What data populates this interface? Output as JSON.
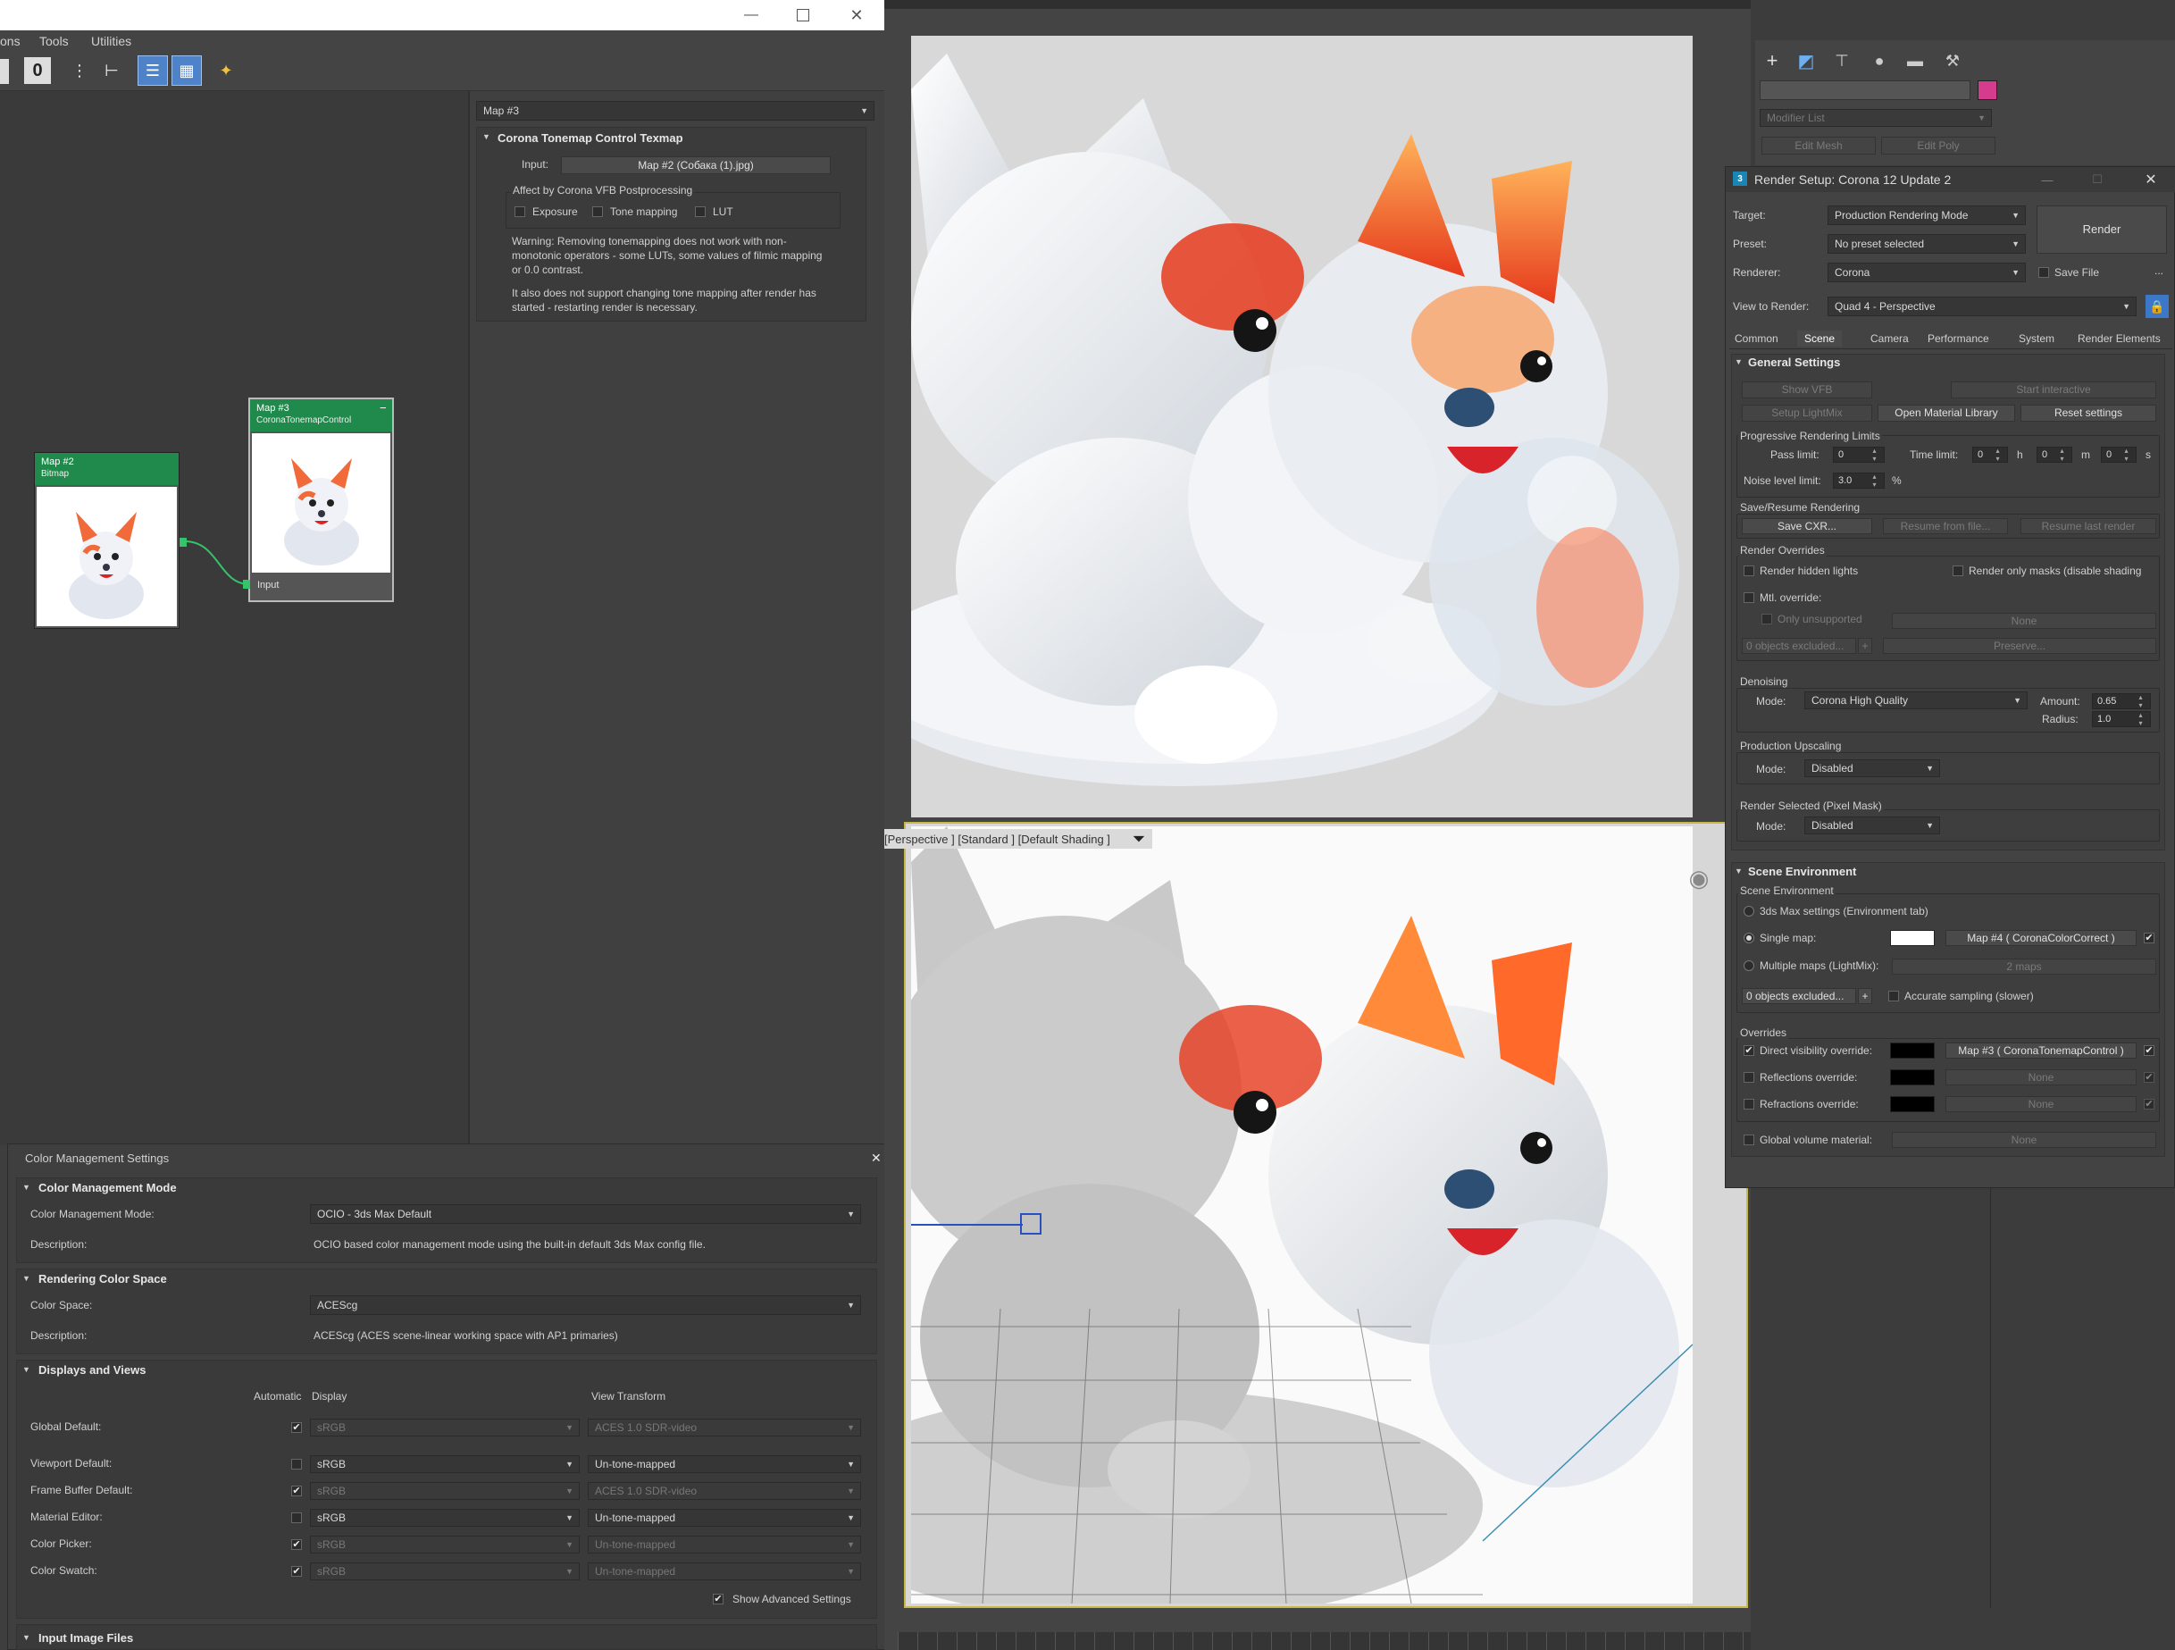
{
  "menu": {
    "items": [
      "ons",
      "Tools",
      "Utilities"
    ]
  },
  "toolbar": {
    "zero": "0"
  },
  "param_editor": {
    "map_name": "Map #3",
    "rollout_title": "Corona Tonemap Control Texmap",
    "input_label": "Input:",
    "input_value": "Map #2 (Собака (1).jpg)",
    "affect_label": "Affect by Corona VFB Postprocessing",
    "exposure": "Exposure",
    "tone_mapping": "Tone mapping",
    "lut": "LUT",
    "warning": "Warning: Removing tonemapping does not work with non-monotonic operators - some LUTs, some values of filmic mapping or 0.0 contrast.",
    "note": "It also does not support changing tone mapping after render has started - restarting render is necessary."
  },
  "nodes": {
    "map2": {
      "title": "Map #2",
      "type": "Bitmap"
    },
    "map3": {
      "title": "Map #3",
      "type": "CoronaTonemapControl",
      "port": "Input",
      "collapse": "−"
    }
  },
  "viewport": {
    "label": "[Perspective ] [Standard ] [Default Shading ]"
  },
  "command_panel": {
    "modifier_list": "Modifier List",
    "edit_mesh": "Edit Mesh",
    "edit_poly": "Edit Poly",
    "color": "#d63c8e"
  },
  "render_setup": {
    "title": "Render Setup: Corona 12 Update 2",
    "target_label": "Target:",
    "target": "Production Rendering Mode",
    "preset_label": "Preset:",
    "preset": "No preset selected",
    "renderer_label": "Renderer:",
    "renderer": "Corona",
    "save_file": "Save File",
    "more": "...",
    "view_label": "View to Render:",
    "view": "Quad 4 - Perspective",
    "render_btn": "Render",
    "tabs": [
      "Common",
      "Scene",
      "Camera",
      "Performance",
      "System",
      "Render Elements"
    ],
    "general": {
      "title": "General Settings",
      "show_vfb": "Show VFB",
      "start_interactive": "Start interactive",
      "setup_lightmix": "Setup LightMix",
      "open_material_library": "Open Material Library",
      "reset_settings": "Reset settings",
      "prog_title": "Progressive Rendering Limits",
      "pass_limit_label": "Pass limit:",
      "pass_limit": "0",
      "time_limit_label": "Time limit:",
      "h": "0",
      "h_unit": "h",
      "m": "0",
      "m_unit": "m",
      "s": "0",
      "s_unit": "s",
      "noise_label": "Noise level limit:",
      "noise": "3.0",
      "percent": "%",
      "save_title": "Save/Resume Rendering",
      "save_cxr": "Save CXR...",
      "resume_file": "Resume from file...",
      "resume_last": "Resume last render",
      "overrides_title": "Render Overrides",
      "render_hidden": "Render hidden lights",
      "render_masks": "Render only masks (disable shading",
      "mtl_override": "Mtl. override:",
      "only_unsupported": "Only unsupported",
      "none": "None",
      "objects_excluded": "0 objects excluded...",
      "plus": "+",
      "preserve": "Preserve...",
      "denoise_title": "Denoising",
      "mode_label": "Mode:",
      "denoise_mode": "Corona High Quality",
      "amount_label": "Amount:",
      "amount": "0.65",
      "radius_label": "Radius:",
      "radius": "1.0",
      "upscale_title": "Production Upscaling",
      "upscale_mode": "Disabled",
      "mask_title": "Render Selected (Pixel Mask)",
      "mask_mode": "Disabled"
    },
    "scene_env": {
      "title": "Scene Environment",
      "sub": "Scene Environment",
      "opt1": "3ds Max settings (Environment tab)",
      "opt2": "Single map:",
      "single_map": "Map #4  ( CoronaColorCorrect )",
      "opt3": "Multiple maps (LightMix):",
      "maps": "2 maps",
      "objects_excluded": "0 objects excluded...",
      "plus": "+",
      "accurate": "Accurate sampling (slower)",
      "overrides": "Overrides",
      "direct": "Direct visibility override:",
      "direct_map": "Map #3  ( CoronaTonemapControl )",
      "reflections": "Reflections override:",
      "refractions": "Refractions override:",
      "none": "None",
      "global_volume": "Global volume material:"
    }
  },
  "color_mgmt": {
    "title": "Color Management Settings",
    "close": "✕",
    "mode_section": "Color Management Mode",
    "mode_label": "Color Management Mode:",
    "mode": "OCIO - 3ds Max Default",
    "desc_label": "Description:",
    "mode_desc": "OCIO based color management mode using the built-in default 3ds Max config file.",
    "space_section": "Rendering Color Space",
    "space_label": "Color Space:",
    "space": "ACEScg",
    "space_desc": "ACEScg (ACES scene-linear working space with AP1 primaries)",
    "displays_section": "Displays and Views",
    "col_automatic": "Automatic",
    "col_display": "Display",
    "col_view": "View Transform",
    "rows": [
      {
        "label": "Global Default:",
        "auto": true,
        "display": "sRGB",
        "view": "ACES 1.0 SDR-video",
        "dis": true
      },
      {
        "label": "Viewport Default:",
        "auto": false,
        "display": "sRGB",
        "view": "Un-tone-mapped",
        "dis": false
      },
      {
        "label": "Frame Buffer Default:",
        "auto": true,
        "display": "sRGB",
        "view": "ACES 1.0 SDR-video",
        "dis": true
      },
      {
        "label": "Material Editor:",
        "auto": false,
        "display": "sRGB",
        "view": "Un-tone-mapped",
        "dis": false
      },
      {
        "label": "Color Picker:",
        "auto": true,
        "display": "sRGB",
        "view": "Un-tone-mapped",
        "dis": true
      },
      {
        "label": "Color Swatch:",
        "auto": true,
        "display": "sRGB",
        "view": "Un-tone-mapped",
        "dis": true
      }
    ],
    "show_advanced": "Show Advanced Settings",
    "input_section": "Input Image Files"
  }
}
